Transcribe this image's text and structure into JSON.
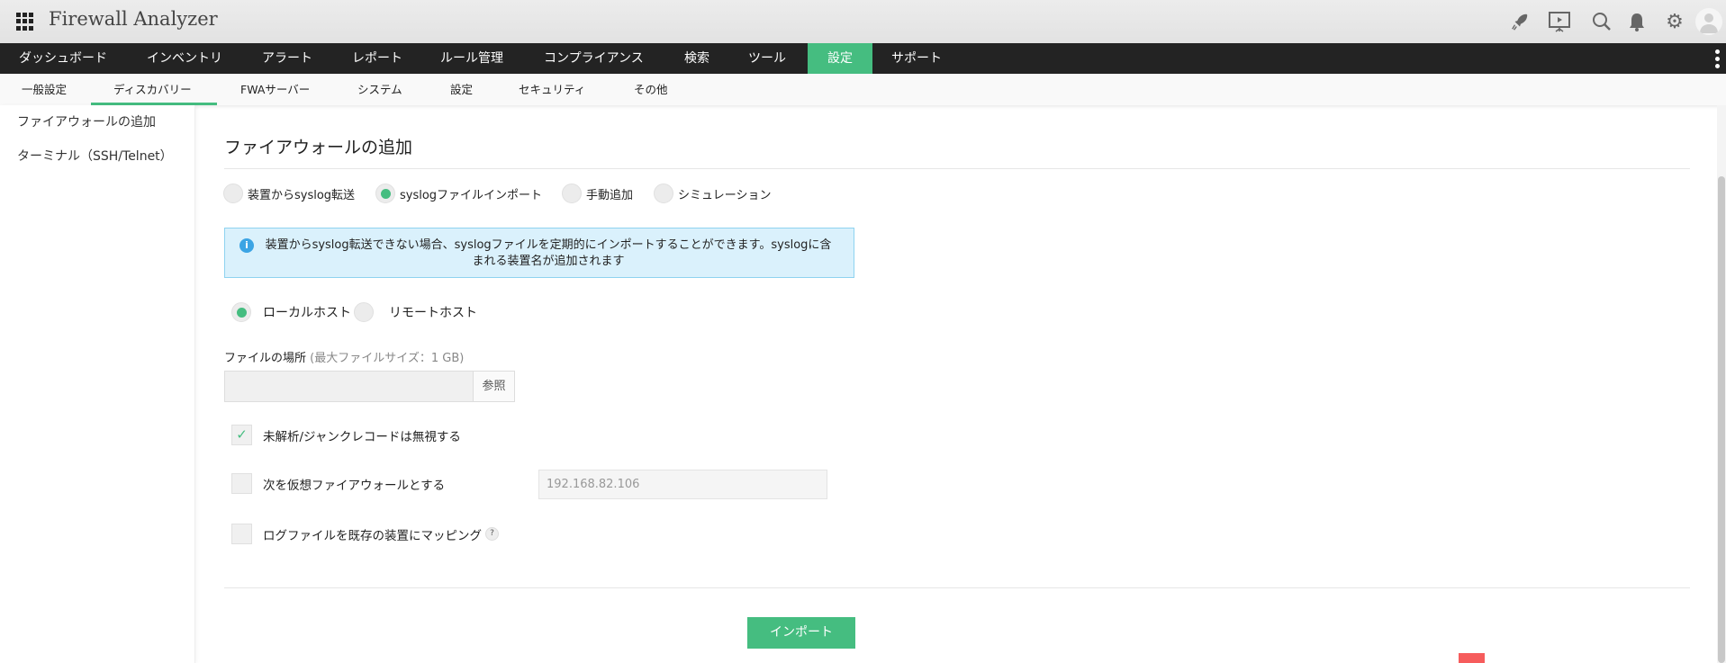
{
  "app": {
    "title": "Firewall Analyzer",
    "header_icons": [
      "rocket-icon",
      "presentation-icon",
      "search-icon",
      "bell-icon",
      "gear-icon",
      "avatar-icon"
    ]
  },
  "nav": {
    "items": [
      "ダッシュボード",
      "インベントリ",
      "アラート",
      "レポート",
      "ルール管理",
      "コンプライアンス",
      "検索",
      "ツール",
      "設定",
      "サポート"
    ],
    "active": "設定"
  },
  "subnav": {
    "items": [
      "一般設定",
      "ディスカバリー",
      "FWAサーバー",
      "システム",
      "設定",
      "セキュリティ",
      "その他"
    ],
    "active": "ディスカバリー"
  },
  "sidebar": {
    "items": [
      "ファイアウォールの追加",
      "ターミナル（SSH/Telnet）"
    ]
  },
  "main": {
    "title": "ファイアウォールの追加",
    "modes": [
      "装置からsyslog転送",
      "syslogファイルインポート",
      "手動追加",
      "シミュレーション"
    ],
    "selected_mode": "syslogファイルインポート",
    "info": "装置からsyslog転送できない場合、syslogファイルを定期的にインポートすることができます。syslogに含まれる装置名が追加されます",
    "hosts": [
      "ローカルホスト",
      "リモートホスト"
    ],
    "selected_host": "ローカルホスト",
    "file_label": "ファイルの場所",
    "file_hint": "(最大ファイルサイズ：1 GB)",
    "file_value": "",
    "browse": "参照",
    "ignore_junk": {
      "label": "未解析/ジャンクレコードは無視する",
      "checked": true
    },
    "virtual_fw": {
      "label": "次を仮想ファイアウォールとする",
      "checked": false,
      "placeholder": "192.168.82.106"
    },
    "map_device": {
      "label": "ログファイルを既存の装置にマッピング",
      "checked": false,
      "help": "?"
    },
    "import": "インポート"
  },
  "colors": {
    "accent": "#45bd80",
    "nav_bg": "#232323",
    "info_bg": "#daf1fc"
  }
}
